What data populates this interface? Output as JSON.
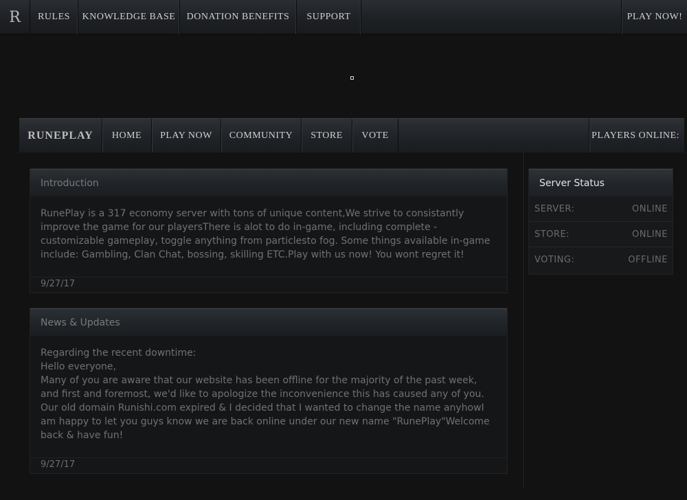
{
  "topnav": {
    "logo": "R",
    "items": [
      "RULES",
      "KNOWLEDGE BASE",
      "DONATION BENEFITS",
      "SUPPORT"
    ],
    "play": "PLAY NOW!"
  },
  "subnav": {
    "brand": "RUNEPLAY",
    "items": [
      "HOME",
      "PLAY NOW",
      "COMMUNITY",
      "STORE",
      "VOTE"
    ],
    "players_label": "PLAYERS ONLINE:",
    "players_count": ""
  },
  "panels": [
    {
      "title": "Introduction",
      "body": "RunePlay is a 317 economy server with tons of unique content,We strive to consistantly\nimprove the game for our playersThere is alot to do in-game, including complete -\ncustomizable gameplay, toggle anything from particlesto fog. Some things available in-game\ninclude: Gambling, Clan Chat, bossing, skilling ETC.Play with us now! You wont regret it!",
      "date": "9/27/17"
    },
    {
      "title": "News & Updates",
      "body": "Regarding the recent downtime:\nHello everyone,\nMany of you are aware that our website has been offline for the majority of the past week,\nand first and foremost, we'd like to apologize the inconvenience this has caused any of you.\nOur old domain Runishi.com expired & I decided that I wanted to change the name anyhowI\nam happy to let you guys know we are back online under our new name \"RunePlay\"Welcome\nback & have fun!",
      "date": "9/27/17"
    }
  ],
  "server_status": {
    "title": "Server Status",
    "rows": [
      {
        "label": "SERVER:",
        "value": "ONLINE"
      },
      {
        "label": "STORE:",
        "value": "ONLINE"
      },
      {
        "label": "VOTING:",
        "value": "OFFLINE"
      }
    ]
  }
}
